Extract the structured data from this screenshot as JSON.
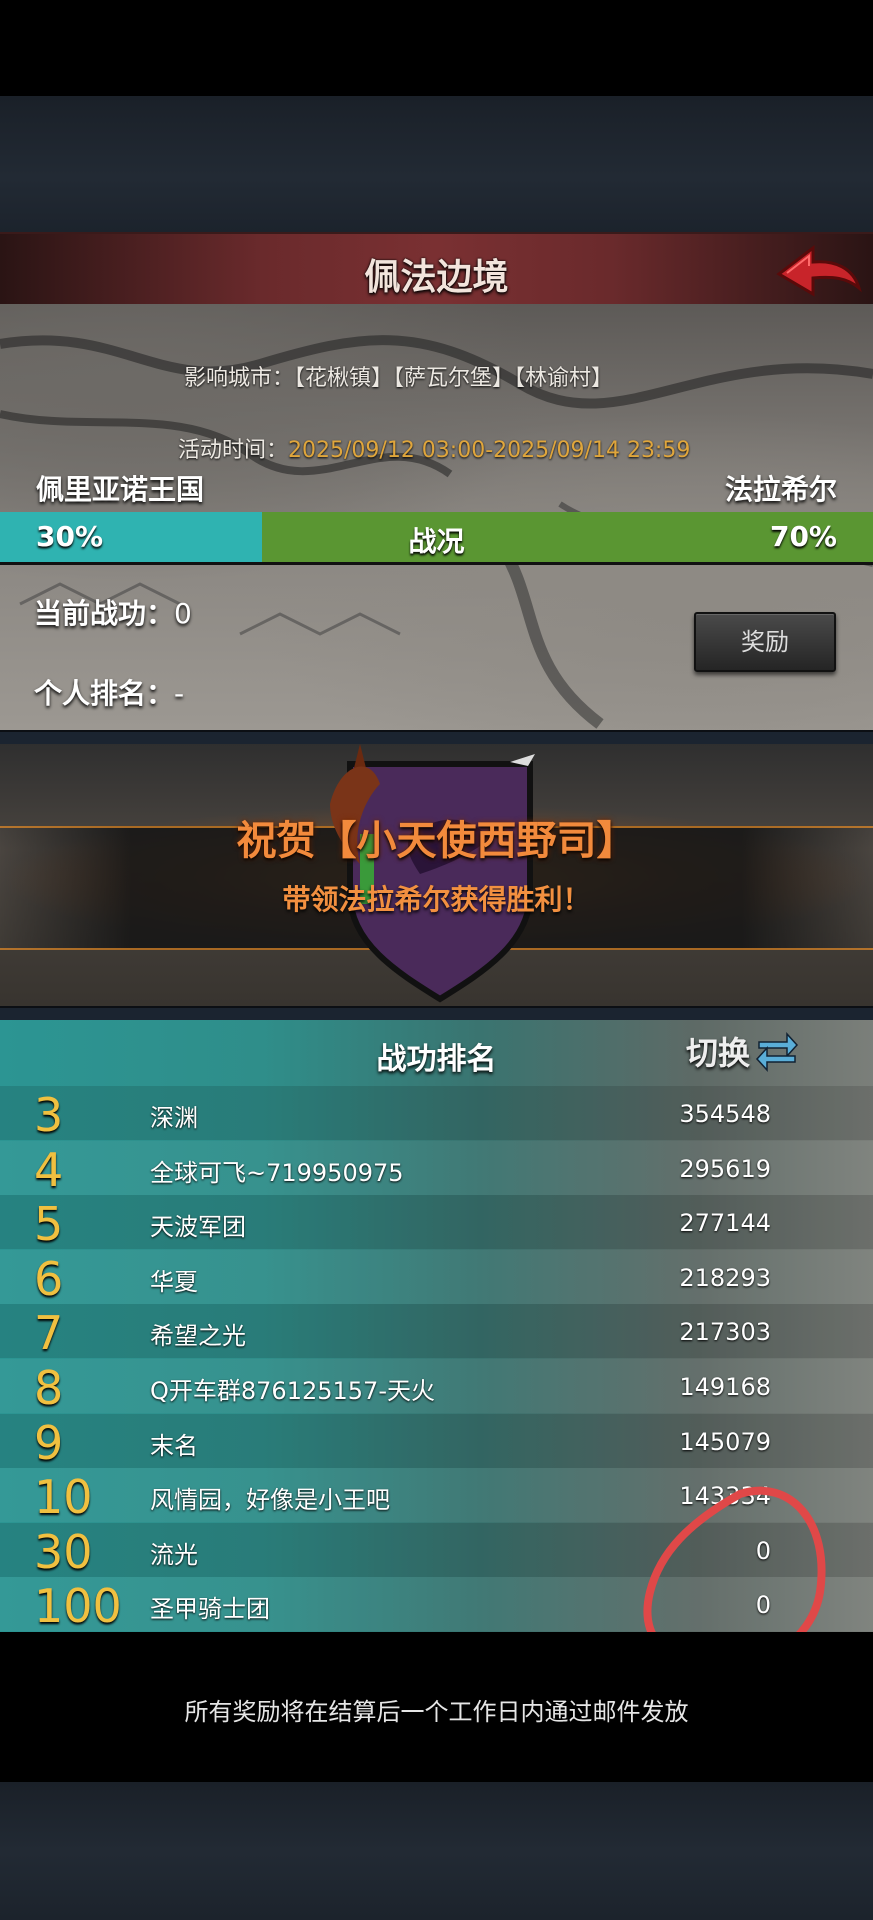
{
  "header": {
    "title": "佩法边境"
  },
  "info": {
    "cities_label": "影响城市：",
    "cities_value": "【花楸镇】【萨瓦尔堡】【林谕村】",
    "time_label": "活动时间：",
    "time_value": "2025/09/12 03:00-2025/09/14 23:59"
  },
  "war": {
    "left_faction": "佩里亚诺王国",
    "right_faction": "法拉希尔",
    "left_percent": "30%",
    "right_percent": "70%",
    "label": "战况",
    "left_value": 30,
    "right_value": 70,
    "left_color": "#2fb3b1",
    "right_color": "#5a9632"
  },
  "personal": {
    "merit_label": "当前战功：",
    "merit_value": "0",
    "rank_label": "个人排名：",
    "rank_value": "-",
    "reward_button": "奖励"
  },
  "banner": {
    "congrats": "祝贺【小天使西野司】",
    "lead": "带领法拉希尔获得胜利！"
  },
  "ranking": {
    "title": "战功排名",
    "switch_label": "切换",
    "rows": [
      {
        "rank": "3",
        "name": "深渊",
        "score": "354548"
      },
      {
        "rank": "4",
        "name": "全球可飞~719950975",
        "score": "295619"
      },
      {
        "rank": "5",
        "name": "天波军团",
        "score": "277144"
      },
      {
        "rank": "6",
        "name": "华夏",
        "score": "218293"
      },
      {
        "rank": "7",
        "name": "希望之光",
        "score": "217303"
      },
      {
        "rank": "8",
        "name": "Q开车群876125157-天火",
        "score": "149168"
      },
      {
        "rank": "9",
        "name": "末名",
        "score": "145079"
      },
      {
        "rank": "10",
        "name": "风情园，好像是小王吧",
        "score": "143334"
      },
      {
        "rank": "30",
        "name": "流光",
        "score": "0"
      },
      {
        "rank": "100",
        "name": "圣甲骑士团",
        "score": "0"
      }
    ]
  },
  "footer": {
    "text": "所有奖励将在结算后一个工作日内通过邮件发放"
  },
  "icons": {
    "back": "back-arrow-icon",
    "switch": "swap-arrows-icon",
    "banner": "faction-banner-icon"
  },
  "colors": {
    "annotation": "#e04848",
    "rank_number": "#f0c040",
    "banner_text": "#f28a3c"
  }
}
